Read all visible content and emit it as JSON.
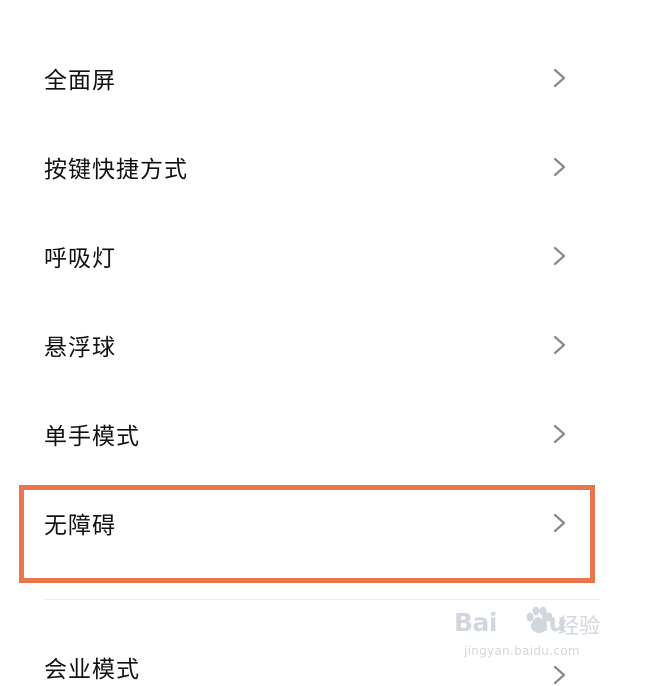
{
  "settings": {
    "items": [
      {
        "label": "全面屏"
      },
      {
        "label": "按键快捷方式"
      },
      {
        "label": "呼吸灯"
      },
      {
        "label": "悬浮球"
      },
      {
        "label": "单手模式"
      },
      {
        "label": "无障碍"
      }
    ],
    "partial_item": {
      "label": "会业模式"
    }
  },
  "highlight": {
    "target": "无障碍",
    "color": "#e8764c"
  },
  "icons": {
    "chevron": "chevron-right-icon",
    "paw": "paw-icon"
  },
  "colors": {
    "text": "#111111",
    "chevron": "#8a8a8a",
    "highlight_border": "#e8764c",
    "divider": "#ededed",
    "watermark": "#d2d6dd"
  },
  "watermark": {
    "brand_left": "Bai",
    "brand_right": "du",
    "product": "经验",
    "domain": "jingyan.baidu.com"
  }
}
